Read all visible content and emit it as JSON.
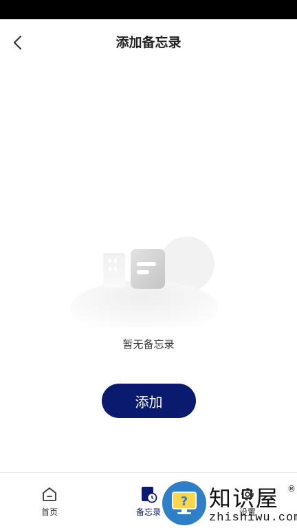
{
  "header": {
    "title": "添加备忘录"
  },
  "empty_state": {
    "message": "暂无备忘录"
  },
  "actions": {
    "add_label": "添加"
  },
  "tabbar": {
    "items": [
      {
        "label": "首页",
        "icon": "home-icon"
      },
      {
        "label": "备忘录",
        "icon": "memo-clock-icon",
        "active": true
      },
      {
        "label": "设置",
        "icon": "gear-icon"
      }
    ]
  },
  "watermark": {
    "brand": "知识屋",
    "url": "zhishiwu.com",
    "reg": "®"
  },
  "colors": {
    "accent": "#0a1a6e",
    "status_bar": "#000000"
  }
}
